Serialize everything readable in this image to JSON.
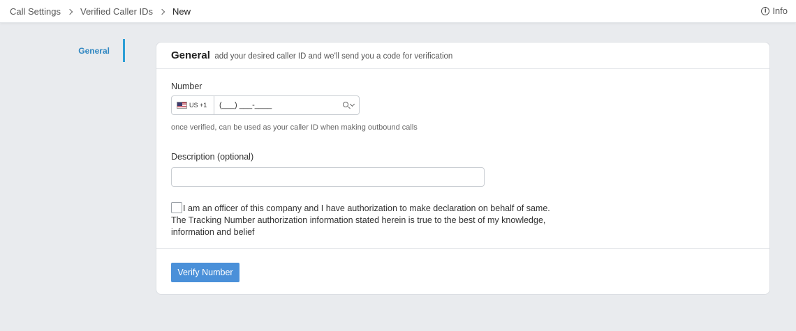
{
  "breadcrumb": {
    "items": [
      "Call Settings",
      "Verified Caller IDs",
      "New"
    ]
  },
  "header": {
    "info_label": "Info",
    "info_icon": "info-icon"
  },
  "sidebar": {
    "items": [
      {
        "label": "General",
        "active": true
      }
    ]
  },
  "card": {
    "title": "General",
    "subtitle": "add your desired caller ID and we'll send you a code for verification",
    "number_label": "Number",
    "country_code": "US +1",
    "phone_placeholder": "(___) ___-____",
    "hint": "once verified, can be used as your caller ID when making outbound calls",
    "description_label": "Description (optional)",
    "description_value": "",
    "consent_text": "I am an officer of this company and I have authorization to make declaration on behalf of same. The Tracking Number authorization information stated herein is true to the best of my knowledge, information and belief",
    "verify_label": "Verify Number"
  },
  "colors": {
    "accent": "#2e9fd6",
    "button": "#4a90d9",
    "background": "#e9ebee"
  }
}
